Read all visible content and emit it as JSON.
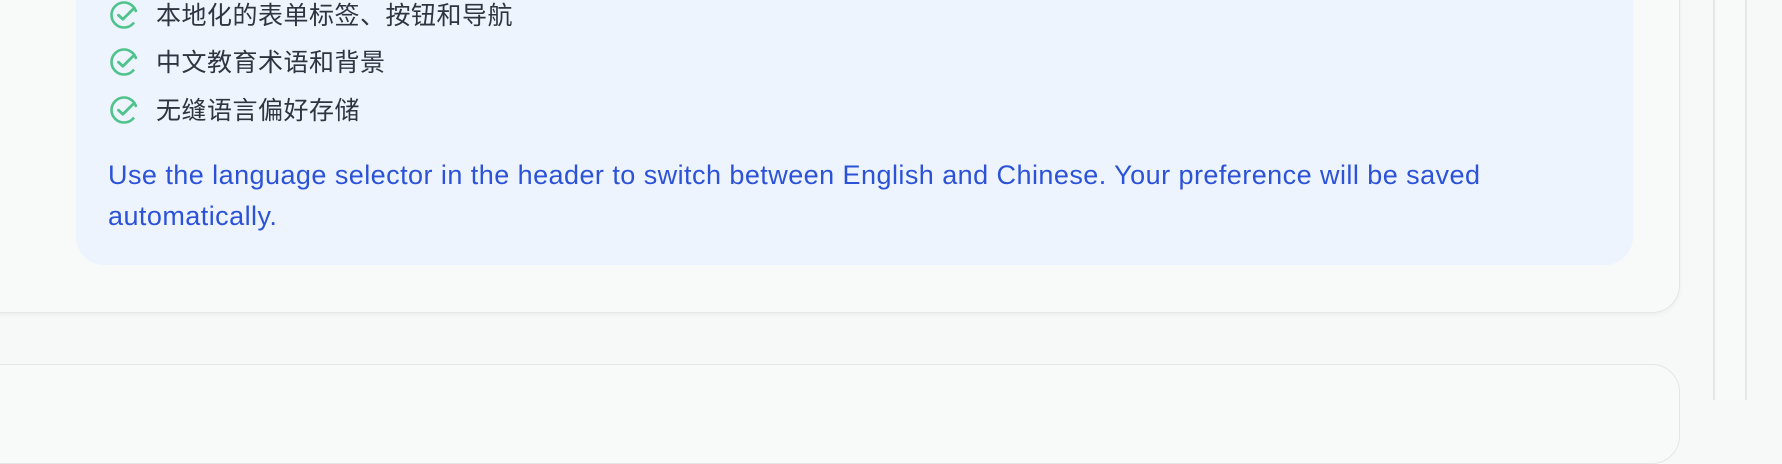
{
  "features": {
    "items": [
      {
        "label": "本地化的表单标签、按钮和导航",
        "icon": "check-circle-icon"
      },
      {
        "label": "中文教育术语和背景",
        "icon": "check-circle-icon"
      },
      {
        "label": "无缝语言偏好存储",
        "icon": "check-circle-icon"
      }
    ]
  },
  "note": {
    "text": "Use the language selector in the header to switch between English and Chinese. Your preference will be saved automatically."
  },
  "colors": {
    "info_background": "#edf4fe",
    "check_green": "#4fc38b",
    "note_blue": "#2c52d8",
    "text_dark": "#2e3440",
    "page_background": "#f7f8f8"
  }
}
